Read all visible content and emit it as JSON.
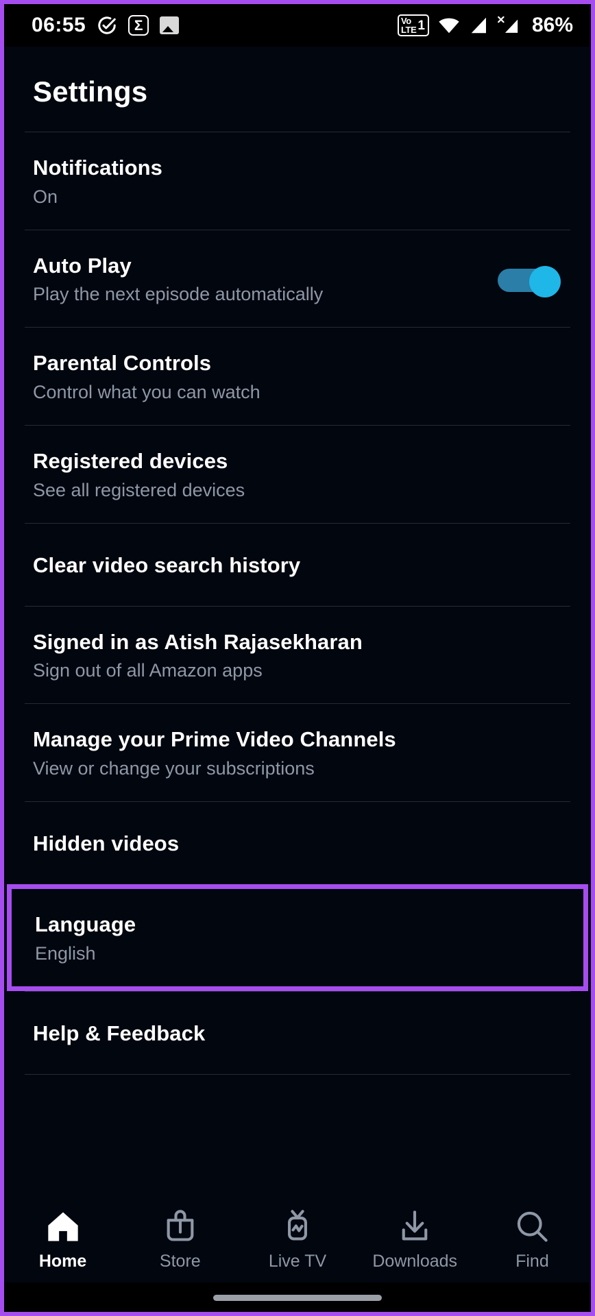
{
  "status_bar": {
    "time": "06:55",
    "battery": "86%",
    "icons_left": [
      "check-circle-icon",
      "sigma-icon",
      "photo-icon"
    ],
    "icons_right": [
      "volte-icon",
      "wifi-icon",
      "signal-icon",
      "signal-no-service-icon"
    ],
    "volte_label": "Vo",
    "volte_label2": "LTE",
    "volte_sim": "1",
    "sigma_glyph": "Σ"
  },
  "header": {
    "title": "Settings"
  },
  "settings": {
    "rows": [
      {
        "title": "Notifications",
        "sub": "On",
        "control": "none"
      },
      {
        "title": "Auto Play",
        "sub": "Play the next episode automatically",
        "control": "toggle",
        "toggle_on": true
      },
      {
        "title": "Parental Controls",
        "sub": "Control what you can watch",
        "control": "none"
      },
      {
        "title": "Registered devices",
        "sub": "See all registered devices",
        "control": "none"
      },
      {
        "title": "Clear video search history",
        "sub": "",
        "control": "none"
      },
      {
        "title": "Signed in as Atish Rajasekharan",
        "sub": "Sign out of all Amazon apps",
        "control": "none"
      },
      {
        "title": "Manage your Prime Video Channels",
        "sub": "View or change your subscriptions",
        "control": "none"
      },
      {
        "title": "Hidden videos",
        "sub": "",
        "control": "none"
      },
      {
        "title": "Language",
        "sub": "English",
        "control": "none",
        "highlighted": true
      },
      {
        "title": "Help & Feedback",
        "sub": "",
        "control": "none"
      }
    ]
  },
  "bottom_nav": {
    "items": [
      {
        "label": "Home",
        "icon": "home-icon",
        "active": true
      },
      {
        "label": "Store",
        "icon": "shopping-bag-icon",
        "active": false
      },
      {
        "label": "Live TV",
        "icon": "live-tv-icon",
        "active": false
      },
      {
        "label": "Downloads",
        "icon": "download-icon",
        "active": false
      },
      {
        "label": "Find",
        "icon": "search-icon",
        "active": false
      }
    ]
  },
  "colors": {
    "background": "#02060f",
    "status_bar_background": "#000000",
    "accent_toggle": "#1fb6e8",
    "toggle_track": "#2a7ea8",
    "highlight_border": "#a64df0",
    "text_primary": "#ffffff",
    "text_secondary": "#8e98a6",
    "divider": "#262a33"
  }
}
